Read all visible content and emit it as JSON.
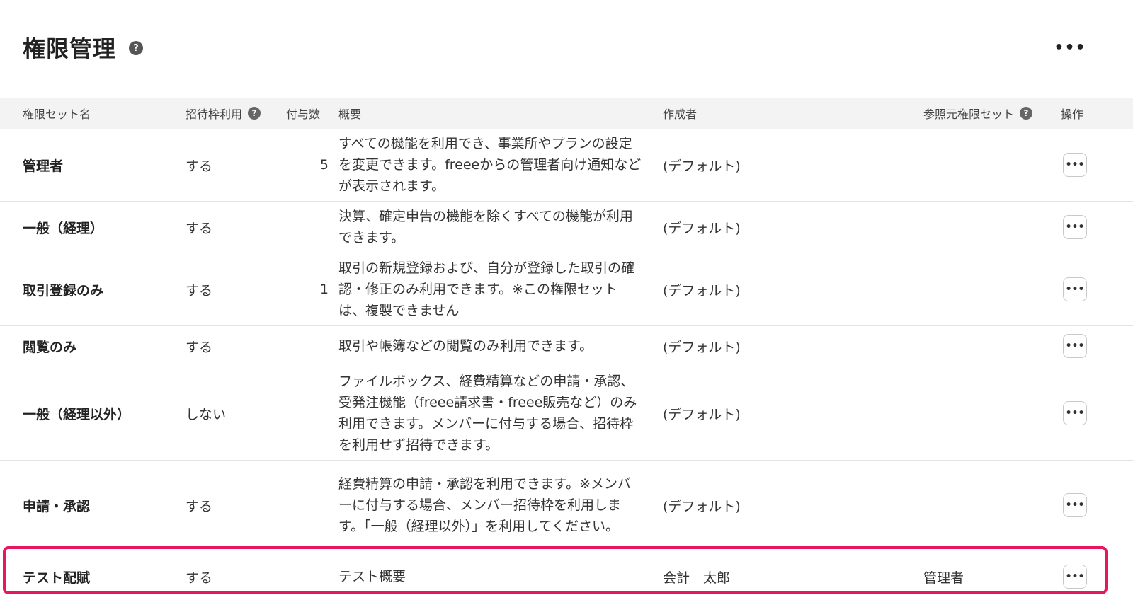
{
  "header": {
    "title": "権限管理",
    "help_glyph": "?",
    "more_glyph": "•••"
  },
  "table": {
    "columns": {
      "name": "権限セット名",
      "invite": "招待枠利用",
      "count": "付与数",
      "description": "概要",
      "author": "作成者",
      "reference": "参照元権限セット",
      "operation": "操作"
    },
    "op_glyph": "•••",
    "rows": [
      {
        "name": "管理者",
        "invite": "する",
        "count": "5",
        "description": "すべての機能を利用でき、事業所やプランの設定を変更できます。freeeからの管理者向け通知などが表示されます。",
        "author": "(デフォルト)",
        "reference": ""
      },
      {
        "name": "一般（経理）",
        "invite": "する",
        "count": "",
        "description": "決算、確定申告の機能を除くすべての機能が利用できます。",
        "author": "(デフォルト)",
        "reference": ""
      },
      {
        "name": "取引登録のみ",
        "invite": "する",
        "count": "1",
        "description": "取引の新規登録および、自分が登録した取引の確認・修正のみ利用できます。※この権限セットは、複製できません",
        "author": "(デフォルト)",
        "reference": ""
      },
      {
        "name": "閲覧のみ",
        "invite": "する",
        "count": "",
        "description": "取引や帳簿などの閲覧のみ利用できます。",
        "author": "(デフォルト)",
        "reference": ""
      },
      {
        "name": "一般（経理以外）",
        "invite": "しない",
        "count": "",
        "description": "ファイルボックス、経費精算などの申請・承認、受発注機能（freee請求書・freee販売など）のみ利用できます。メンバーに付与する場合、招待枠を利用せず招待できます。",
        "author": "(デフォルト)",
        "reference": ""
      },
      {
        "name": "申請・承認",
        "invite": "する",
        "count": "",
        "description": "経費精算の申請・承認を利用できます。※メンバーに付与する場合、メンバー招待枠を利用します。「一般（経理以外）」を利用してください。",
        "author": "(デフォルト)",
        "reference": ""
      },
      {
        "name": "テスト配賦",
        "invite": "する",
        "count": "",
        "description": "テスト概要",
        "author": "会計　太郎",
        "reference": "管理者"
      }
    ]
  },
  "colors": {
    "highlight": "#e8175d",
    "header_bg": "#f3f3f3",
    "row_border": "#e3e3e3"
  }
}
